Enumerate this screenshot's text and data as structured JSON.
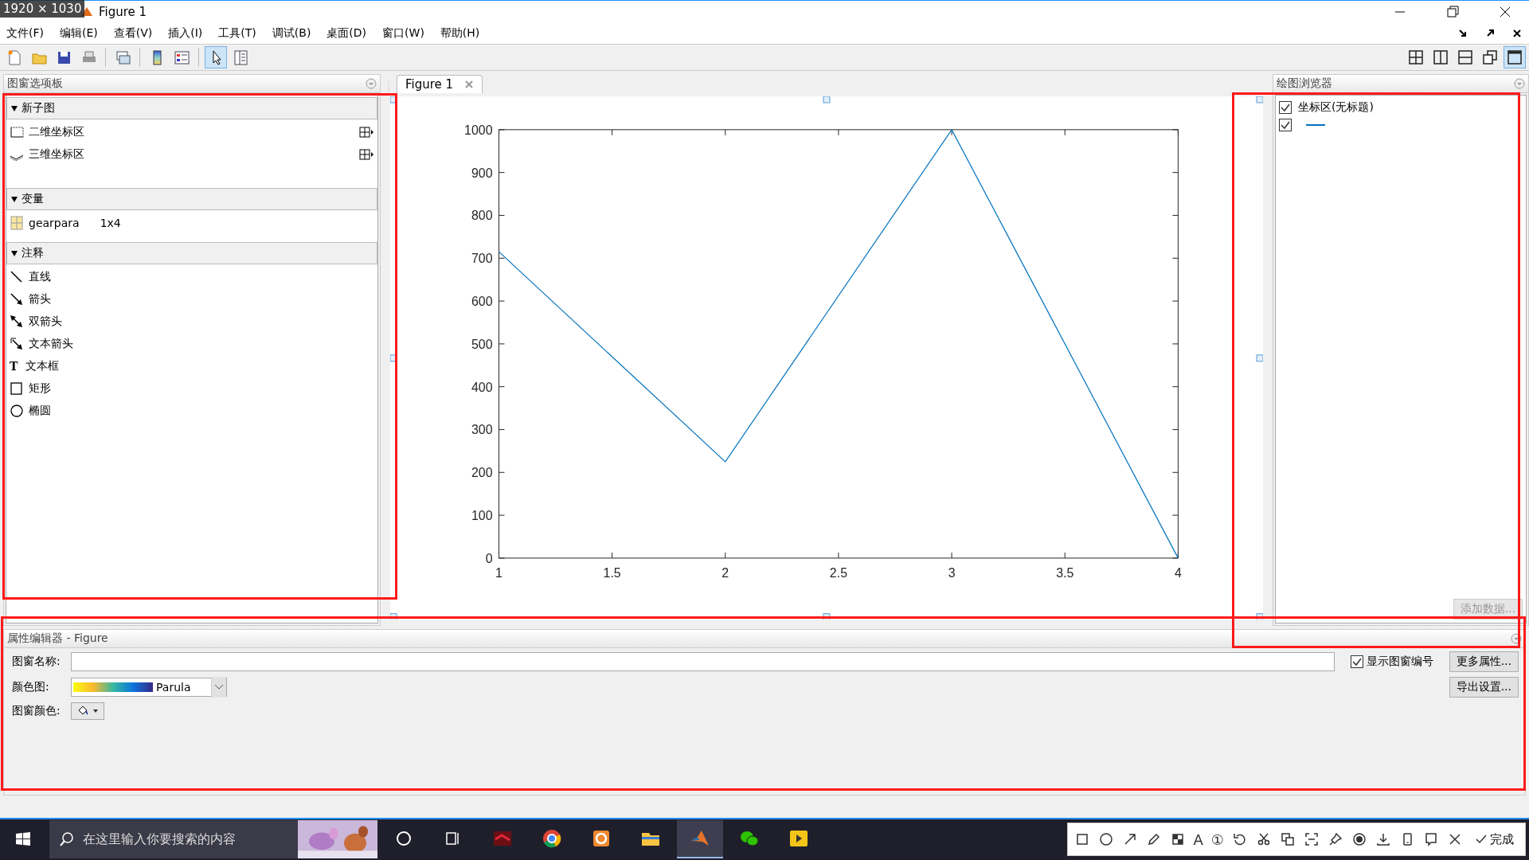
{
  "capture_badge": "1920 × 1030",
  "window": {
    "title": "Figure 1"
  },
  "menu": [
    {
      "label": "文件(F)"
    },
    {
      "label": "编辑(E)"
    },
    {
      "label": "查看(V)"
    },
    {
      "label": "插入(I)"
    },
    {
      "label": "工具(T)"
    },
    {
      "label": "调试(B)"
    },
    {
      "label": "桌面(D)"
    },
    {
      "label": "窗口(W)"
    },
    {
      "label": "帮助(H)"
    }
  ],
  "toolbar": [
    [
      {
        "kind": "new",
        "selected": false
      },
      {
        "kind": "open",
        "selected": false
      },
      {
        "kind": "save",
        "selected": false
      },
      {
        "kind": "print",
        "selected": false
      }
    ],
    [
      {
        "kind": "link",
        "selected": false
      }
    ],
    [
      {
        "kind": "colorbar",
        "selected": false
      },
      {
        "kind": "legend",
        "selected": false
      }
    ],
    [
      {
        "kind": "pointer",
        "selected": true
      },
      {
        "kind": "panel",
        "selected": false
      }
    ]
  ],
  "layout_buttons": [
    {
      "kind": "grid",
      "selected": false
    },
    {
      "kind": "cols",
      "selected": false
    },
    {
      "kind": "rows",
      "selected": false
    },
    {
      "kind": "float",
      "selected": false
    },
    {
      "kind": "max",
      "selected": true
    }
  ],
  "palette": {
    "title": "图窗选项板",
    "sections": [
      {
        "title": "新子图",
        "expanded": true,
        "items": [
          {
            "kind": "axes2d",
            "label": "二维坐标区"
          },
          {
            "kind": "axes3d",
            "label": "三维坐标区"
          }
        ]
      },
      {
        "title": "变量",
        "expanded": true,
        "items": [
          {
            "kind": "variable",
            "label": "gearpara",
            "size": "1x4"
          }
        ]
      },
      {
        "title": "注释",
        "expanded": true,
        "items": [
          {
            "kind": "line",
            "label": "直线"
          },
          {
            "kind": "arrow",
            "label": "箭头"
          },
          {
            "kind": "doublearrow",
            "label": "双箭头"
          },
          {
            "kind": "textarrow",
            "label": "文本箭头"
          },
          {
            "kind": "textbox",
            "label": "文本框",
            "glyph": "T"
          },
          {
            "kind": "rectangle",
            "label": "矩形"
          },
          {
            "kind": "ellipse",
            "label": "椭圆"
          }
        ]
      }
    ]
  },
  "figure_tab": {
    "label": "Figure 1"
  },
  "chart_data": {
    "type": "line",
    "x": [
      1,
      2,
      3,
      4
    ],
    "series": [
      {
        "color": "#0072bd",
        "values": [
          715,
          225,
          1000,
          0
        ]
      }
    ],
    "xlim": [
      1,
      4
    ],
    "ylim": [
      0,
      1000
    ],
    "xticks": [
      1,
      1.5,
      2,
      2.5,
      3,
      3.5,
      4
    ],
    "yticks": [
      0,
      100,
      200,
      300,
      400,
      500,
      600,
      700,
      800,
      900,
      1000
    ]
  },
  "plot_browser": {
    "title": "绘图浏览器",
    "items": [
      {
        "kind": "axes",
        "label": "坐标区(无标题)",
        "checked": true
      },
      {
        "kind": "line",
        "checked": true
      }
    ],
    "add_button": {
      "label": "添加数据...",
      "disabled": true
    }
  },
  "property_editor": {
    "title": "属性编辑器 - Figure",
    "name_label": "图窗名称:",
    "show_number": {
      "label": "显示图窗编号",
      "checked": true
    },
    "more_button": "更多属性...",
    "colormap_label": "颜色图:",
    "colormap": "Parula",
    "export_button": "导出设置...",
    "color_label": "图窗颜色:"
  },
  "taskbar": {
    "search_placeholder": "在这里输入你要搜索的内容",
    "apps": [
      {
        "kind": "cortana",
        "selected": false
      },
      {
        "kind": "taskview",
        "selected": false
      },
      {
        "kind": "redapp",
        "selected": false
      },
      {
        "kind": "chrome",
        "selected": false
      },
      {
        "kind": "orangeapp",
        "selected": false
      },
      {
        "kind": "folder",
        "selected": false
      },
      {
        "kind": "matlab",
        "selected": true
      },
      {
        "kind": "chat",
        "selected": false
      },
      {
        "kind": "player",
        "selected": false
      }
    ]
  },
  "capture_toolbar": {
    "tools": [
      {
        "kind": "rect"
      },
      {
        "kind": "ellipse"
      },
      {
        "kind": "arrow"
      },
      {
        "kind": "pen"
      },
      {
        "kind": "mosaic"
      },
      {
        "kind": "text",
        "glyph": "A"
      },
      {
        "kind": "number",
        "glyph": "①"
      },
      {
        "kind": "undo"
      },
      {
        "kind": "scissors"
      },
      {
        "kind": "translate"
      },
      {
        "kind": "scan"
      },
      {
        "kind": "pin"
      },
      {
        "kind": "record"
      },
      {
        "kind": "download"
      },
      {
        "kind": "phone"
      },
      {
        "kind": "bookmark"
      },
      {
        "kind": "close"
      }
    ],
    "done": "完成"
  }
}
